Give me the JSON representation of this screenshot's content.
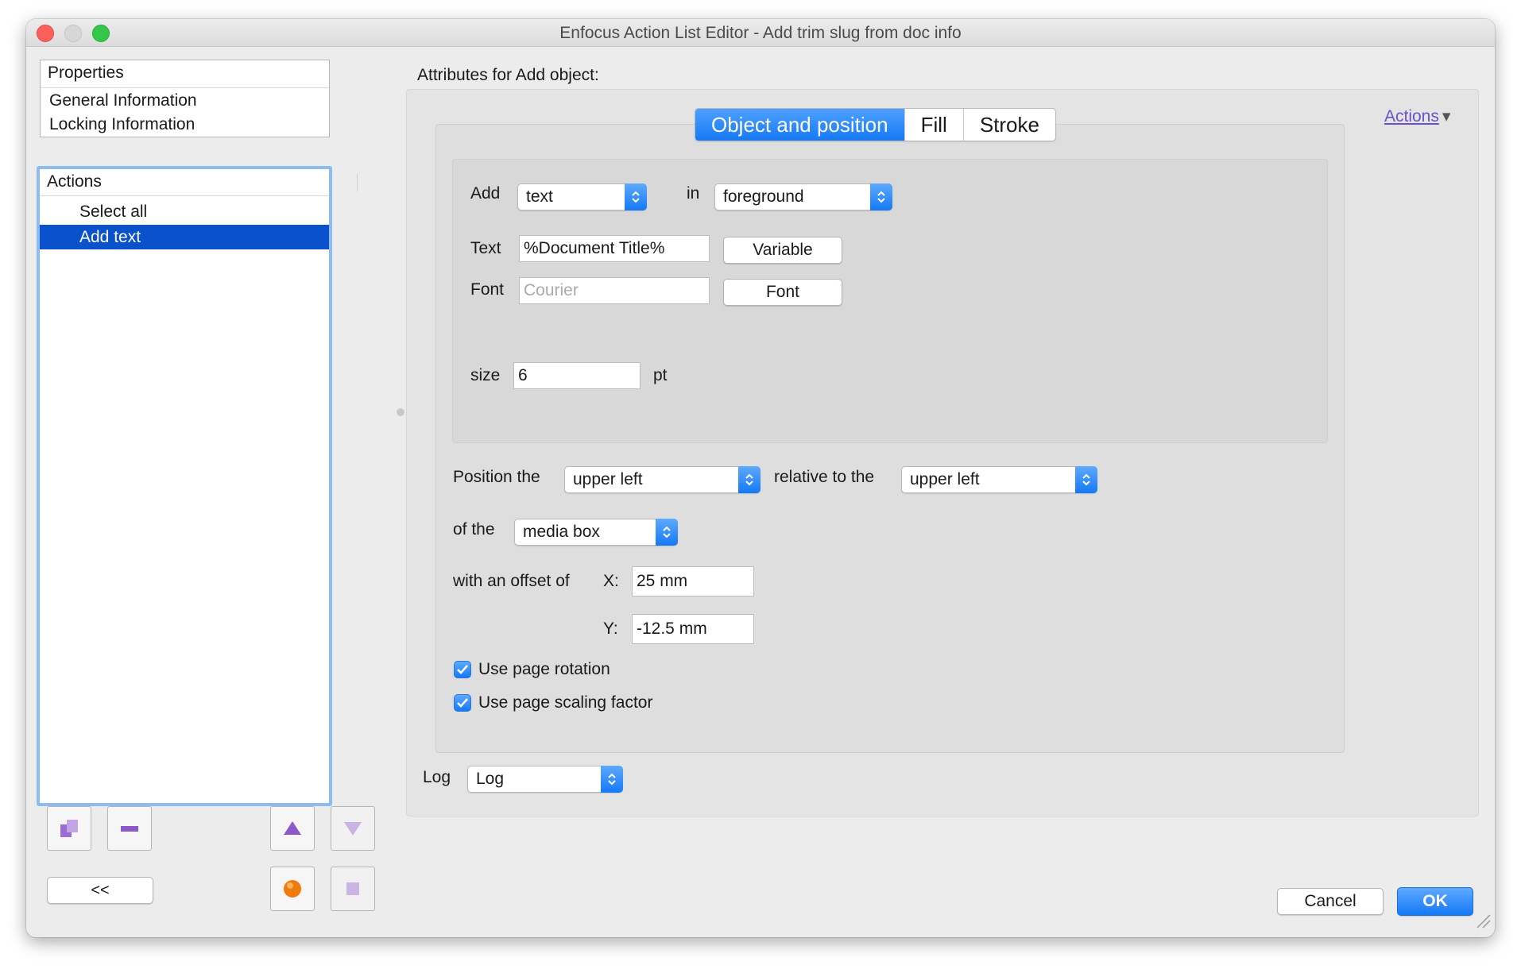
{
  "window": {
    "title": "Enfocus Action List Editor - Add trim slug from doc info"
  },
  "properties": {
    "header": "Properties",
    "items": [
      "General Information",
      "Locking Information"
    ]
  },
  "actions": {
    "header": "Actions",
    "items": [
      {
        "label": "Select all",
        "selected": false
      },
      {
        "label": "Add text",
        "selected": true
      }
    ]
  },
  "bottom_buttons": {
    "collapse_label": "<<"
  },
  "main": {
    "attributes_title": "Attributes for Add object:",
    "actions_menu_label": "Actions",
    "tabs": [
      "Object and position",
      "Fill",
      "Stroke"
    ],
    "active_tab": "Object and position",
    "add_label": "Add",
    "add_value": "text",
    "in_label": "in",
    "in_value": "foreground",
    "text_label": "Text",
    "text_value": "%Document Title%",
    "variable_button": "Variable",
    "font_label": "Font",
    "font_placeholder": "Courier",
    "font_button": "Font",
    "size_label": "size",
    "size_value": "6",
    "size_unit": "pt",
    "position_label": "Position the",
    "position_value": "upper left",
    "relative_label": "relative to the",
    "relative_value": "upper left",
    "of_the_label": "of the",
    "of_the_value": "media box",
    "offset_label": "with an offset of",
    "x_label": "X:",
    "x_value": "25 mm",
    "y_label": "Y:",
    "y_value": "-12.5 mm",
    "use_page_rotation": {
      "label": "Use page rotation",
      "checked": true
    },
    "use_page_scaling": {
      "label": "Use page scaling factor",
      "checked": true
    },
    "log_label": "Log",
    "log_value": "Log"
  },
  "footer": {
    "cancel": "Cancel",
    "ok": "OK"
  },
  "colors": {
    "accent": "#1479f6",
    "selection": "#0a52cc",
    "link": "#6a52c8"
  }
}
